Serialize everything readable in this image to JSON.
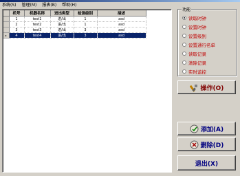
{
  "menu": [
    "系统(S)",
    "管理(M)",
    "报表(B)",
    "帮助(H)"
  ],
  "grid": {
    "headers": [
      "机号",
      "机器名称",
      "进出类型",
      "检测级别",
      "描述"
    ],
    "rows": [
      [
        "1",
        "test1",
        "进/出",
        "1",
        "asd"
      ],
      [
        "2",
        "test2",
        "进/出",
        "1",
        "asd"
      ],
      [
        "3",
        "test3",
        "进/出",
        "3",
        "asd"
      ],
      [
        "4",
        "test4",
        "进/出",
        "3",
        "asd"
      ]
    ],
    "selected_row": 3
  },
  "function_group": {
    "title": "功能",
    "options": [
      "读取时钟",
      "设置时钟",
      "设置级别",
      "设置通行名单",
      "读取记录",
      "清除记录",
      "实时监控"
    ],
    "selected": 0
  },
  "buttons": {
    "operate": "操作(O)",
    "add": "添加(A)",
    "delete": "删除(D)",
    "exit": "退出(X)"
  }
}
